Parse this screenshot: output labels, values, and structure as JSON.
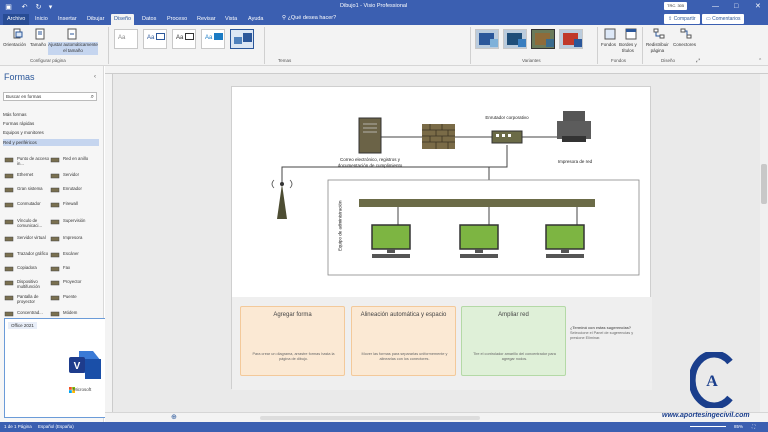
{
  "titlebar": {
    "doc_title": "Dibujo1 - Visio Professional",
    "user": "TRC. 305",
    "window_controls": [
      "—",
      "□",
      "✕"
    ]
  },
  "tabs": {
    "file": "Archivo",
    "items": [
      "Inicio",
      "Insertar",
      "Dibujar",
      "Diseño",
      "Datos",
      "Proceso",
      "Revisar",
      "Vista",
      "Ayuda"
    ],
    "active": "Diseño",
    "tell_me": "¿Qué desea hacer?",
    "share": "Compartir",
    "comments": "Comentarios"
  },
  "ribbon": {
    "page_setup": {
      "orientation": "Orientación",
      "size": "Tamaño",
      "autofit_1": "Ajustar automáticamente",
      "autofit_2": "el tamaño",
      "group": "Configurar página"
    },
    "themes_group": "Temas",
    "variants_group": "Variantes",
    "backgrounds": {
      "bg_1": "Fondos",
      "borders_1": "Bordes y",
      "borders_2": "títulos",
      "group": "Fondos"
    },
    "layout": {
      "relayout_1": "Redistribuir",
      "relayout_2": "página",
      "connectors": "Conectores",
      "group": "Diseño"
    }
  },
  "shapes_pane": {
    "title": "Formas",
    "search_placeholder": "Buscar en formas",
    "stencils": [
      "Más formas",
      "Formas rápidas",
      "Equipos y monitores",
      "Red y periféricos"
    ],
    "shapes_left": [
      "Punto de acceso in...",
      "Ethernet",
      "Gran sistema",
      "Conmutador",
      "Vínculo de comunicaci...",
      "Servidor virtual",
      "Trazador gráfico",
      "Copiadora",
      "Dispositivo multifunción",
      "Pantalla de proyector",
      "Concentrad..."
    ],
    "shapes_right": [
      "Red en anillo",
      "Servidor",
      "Enrutador",
      "Firewall",
      "Supervisión",
      "Impresora",
      "Escáner",
      "Fax",
      "Proyector",
      "Puente",
      "Módem"
    ]
  },
  "office_popup": {
    "chip": "Office 2021",
    "brand": "Microsoft"
  },
  "diagram": {
    "email_server": "Correo electrónico, registros y documentación de cumplimiento",
    "router": "Enrutador corporativo",
    "printer": "Impresora de red",
    "admin_team": "Equipo de administración"
  },
  "cards": [
    {
      "title": "Agregar forma",
      "desc": "Para crear un diagrama, arrastre formas hasta la página de dibujo."
    },
    {
      "title": "Alineación automática y espacio",
      "desc": "Mover las formas para separarlas uniformemente y alinearlas con los conectores."
    },
    {
      "title": "Ampliar red",
      "desc": "Tire el controlador amarillo del concentrador para agregar nodos."
    }
  ],
  "hint": {
    "title": "¿Terminó con estas sugerencias?",
    "body": "Seleccione el Panel de sugerencias y presione Eliminar."
  },
  "status": {
    "page": "1 de 1 Página",
    "language": "Español (España)",
    "zoom": "85%"
  },
  "watermark": "www.aportesingecivil.com",
  "colors": {
    "accent": "#3b5fb1",
    "card_orange": "#fbe9d4",
    "card_green": "#dff0d8",
    "monitor_green": "#8bc34a"
  }
}
